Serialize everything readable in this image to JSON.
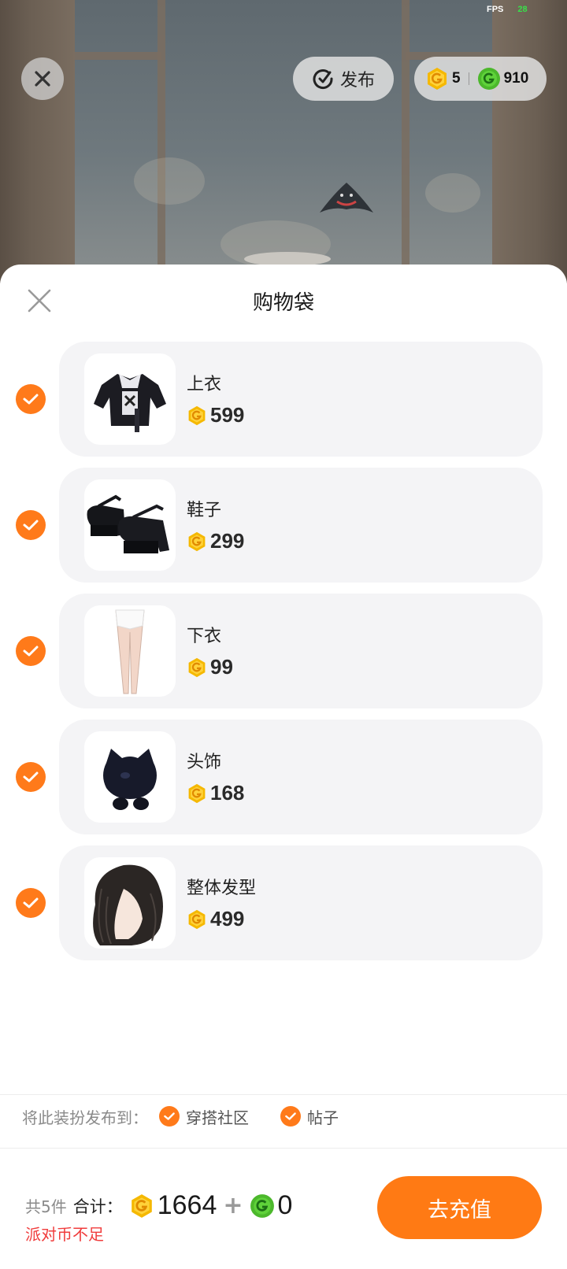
{
  "status": {
    "fps_label": "FPS",
    "fps_value": "28"
  },
  "header": {
    "publish_label": "发布",
    "gold_coin_balance": "5",
    "green_coin_balance": "910"
  },
  "cart": {
    "title": "购物袋",
    "items": [
      {
        "name": "上衣",
        "price": "599",
        "checked": true,
        "thumb_icon": "jacket-icon"
      },
      {
        "name": "鞋子",
        "price": "299",
        "checked": true,
        "thumb_icon": "shoes-icon"
      },
      {
        "name": "下衣",
        "price": "99",
        "checked": true,
        "thumb_icon": "tights-icon"
      },
      {
        "name": "头饰",
        "price": "168",
        "checked": true,
        "thumb_icon": "cat-headpiece-icon"
      },
      {
        "name": "整体发型",
        "price": "499",
        "checked": true,
        "thumb_icon": "hairstyle-icon"
      }
    ]
  },
  "publish_to": {
    "label": "将此装扮发布到：",
    "options": [
      {
        "label": "穿搭社区",
        "checked": true
      },
      {
        "label": "帖子",
        "checked": true
      }
    ]
  },
  "summary": {
    "count_text": "共5件",
    "total_label": "合计：",
    "gold_total": "1664",
    "plus": "+",
    "green_total": "0",
    "warning": "派对币不足"
  },
  "recharge_button": {
    "label": "去充值"
  },
  "colors": {
    "accent": "#ff7a14",
    "warning": "#f03c3c",
    "gold_coin": "#f5b800",
    "green_coin": "#4cb82c"
  }
}
